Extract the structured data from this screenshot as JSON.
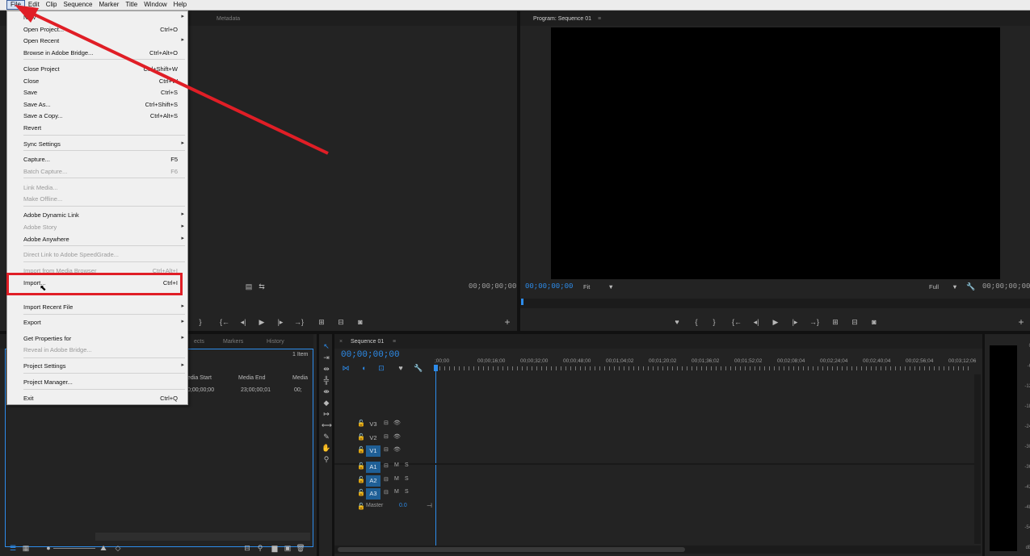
{
  "menubar": [
    "File",
    "Edit",
    "Clip",
    "Sequence",
    "Marker",
    "Title",
    "Window",
    "Help"
  ],
  "source_panel": {
    "tabs": [
      "Metadata"
    ],
    "timecode": "00;00;00;00"
  },
  "program_panel": {
    "title": "Program: Sequence 01",
    "menu_glyph": "≡",
    "timecode_left": "00;00;00;00",
    "fit": "Fit",
    "full": "Full",
    "timecode_right": "00;00;00;00"
  },
  "project_panel": {
    "tabs": [
      "ects",
      "Markers",
      "History"
    ],
    "item_count": "1 Item",
    "columns": [
      "edia Start",
      "Media End",
      "Media"
    ],
    "row": [
      "0;00;00;00",
      "23;00;00;01",
      "00;"
    ]
  },
  "timeline": {
    "tab_close": "×",
    "title": "Sequence 01",
    "menu_glyph": "≡",
    "timecode": "00;00;00;00",
    "ruler": [
      ";00;00",
      "00;00;16;00",
      "00;00;32;00",
      "00;00;48;00",
      "00;01;04;02",
      "00;01;20;02",
      "00;01;36;02",
      "00;01;52;02",
      "00;02;08;04",
      "00;02;24;04",
      "00;02;40;04",
      "00;02;56;04",
      "00;03;12;06"
    ],
    "video_tracks": [
      "V3",
      "V2",
      "V1"
    ],
    "audio_tracks": [
      "A1",
      "A2",
      "A3"
    ],
    "master": "Master",
    "master_value": "0.0",
    "mute": "M",
    "solo": "S"
  },
  "meter_scale": [
    "0",
    "-6",
    "-12",
    "-18",
    "-24",
    "-30",
    "-36",
    "-42",
    "-48",
    "-54",
    "dB"
  ],
  "file_menu": {
    "items": [
      {
        "label": "New",
        "shortcut": "",
        "submenu": true,
        "disabled": false
      },
      {
        "label": "Open Project...",
        "shortcut": "Ctrl+O",
        "submenu": false,
        "disabled": false
      },
      {
        "label": "Open Recent",
        "shortcut": "",
        "submenu": true,
        "disabled": false
      },
      {
        "label": "Browse in Adobe Bridge...",
        "shortcut": "Ctrl+Alt+O",
        "submenu": false,
        "disabled": false
      },
      {
        "label": "Close Project",
        "shortcut": "Ctrl+Shift+W",
        "submenu": false,
        "disabled": false
      },
      {
        "label": "Close",
        "shortcut": "Ctrl+W",
        "submenu": false,
        "disabled": false
      },
      {
        "label": "Save",
        "shortcut": "Ctrl+S",
        "submenu": false,
        "disabled": false
      },
      {
        "label": "Save As...",
        "shortcut": "Ctrl+Shift+S",
        "submenu": false,
        "disabled": false
      },
      {
        "label": "Save a Copy...",
        "shortcut": "Ctrl+Alt+S",
        "submenu": false,
        "disabled": false
      },
      {
        "label": "Revert",
        "shortcut": "",
        "submenu": false,
        "disabled": false
      },
      {
        "label": "Sync Settings",
        "shortcut": "",
        "submenu": true,
        "disabled": false
      },
      {
        "label": "Capture...",
        "shortcut": "F5",
        "submenu": false,
        "disabled": false
      },
      {
        "label": "Batch Capture...",
        "shortcut": "F6",
        "submenu": false,
        "disabled": true
      },
      {
        "label": "Link Media...",
        "shortcut": "",
        "submenu": false,
        "disabled": true
      },
      {
        "label": "Make Offline...",
        "shortcut": "",
        "submenu": false,
        "disabled": true
      },
      {
        "label": "Adobe Dynamic Link",
        "shortcut": "",
        "submenu": true,
        "disabled": false
      },
      {
        "label": "Adobe Story",
        "shortcut": "",
        "submenu": true,
        "disabled": true
      },
      {
        "label": "Adobe Anywhere",
        "shortcut": "",
        "submenu": true,
        "disabled": false
      },
      {
        "label": "Direct Link to Adobe SpeedGrade...",
        "shortcut": "",
        "submenu": false,
        "disabled": true
      },
      {
        "label": "Import from Media Browser",
        "shortcut": "Ctrl+Alt+I",
        "submenu": false,
        "disabled": true
      },
      {
        "label": "Import...",
        "shortcut": "Ctrl+I",
        "submenu": false,
        "disabled": false
      },
      {
        "label": "Import Recent File",
        "shortcut": "",
        "submenu": true,
        "disabled": false
      },
      {
        "label": "Export",
        "shortcut": "",
        "submenu": true,
        "disabled": false
      },
      {
        "label": "Get Properties for",
        "shortcut": "",
        "submenu": true,
        "disabled": false
      },
      {
        "label": "Reveal in Adobe Bridge...",
        "shortcut": "",
        "submenu": false,
        "disabled": true
      },
      {
        "label": "Project Settings",
        "shortcut": "",
        "submenu": true,
        "disabled": false
      },
      {
        "label": "Project Manager...",
        "shortcut": "",
        "submenu": false,
        "disabled": false
      },
      {
        "label": "Exit",
        "shortcut": "Ctrl+Q",
        "submenu": false,
        "disabled": false
      }
    ]
  },
  "colors": {
    "highlight_box": "#e01e26",
    "arrow": "#e01e26",
    "accent_blue": "#2d8ceb",
    "track_selected": "#1f5f96"
  }
}
